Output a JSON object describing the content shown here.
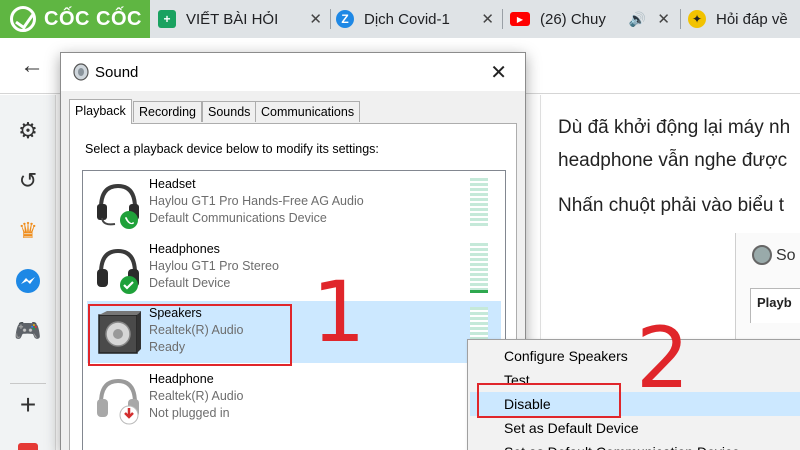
{
  "browser": {
    "logo_text": "CỐC CỐC",
    "tabs": [
      {
        "title": "VIẾT BÀI HỎI",
        "icon": "green-plus-icon",
        "color": "#1aa260"
      },
      {
        "title": "Dịch Covid-1",
        "icon": "zalo-z-icon",
        "color": "#1e88e5"
      },
      {
        "title": "(26) Chuy",
        "icon": "youtube-icon",
        "color": "#ff0000"
      },
      {
        "title": "Hỏi đáp về",
        "icon": "runner-icon",
        "color": "#f2c200"
      }
    ],
    "close_glyph": "✕",
    "back_glyph": "←"
  },
  "article": {
    "lines": [
      "Dù đã khởi động lại máy nh",
      "headphone vẫn nghe được",
      "Nhấn chuột phải vào biểu t"
    ],
    "inset_title": "So",
    "inset_tab": "Playb"
  },
  "dialog": {
    "title": "Sound",
    "close_glyph": "✕",
    "tabs": [
      "Playback",
      "Recording",
      "Sounds",
      "Communications"
    ],
    "instruction": "Select a playback device below to modify its settings:",
    "devices": [
      {
        "name": "Headset",
        "desc": "Haylou GT1 Pro Hands-Free AG Audio",
        "status": "Default Communications Device",
        "badge": "phone"
      },
      {
        "name": "Headphones",
        "desc": "Haylou GT1 Pro Stereo",
        "status": "Default Device",
        "badge": "check"
      },
      {
        "name": "Speakers",
        "desc": "Realtek(R) Audio",
        "status": "Ready",
        "badge": "none"
      },
      {
        "name": "Headphone",
        "desc": "Realtek(R) Audio",
        "status": "Not plugged in",
        "badge": "unplugged"
      }
    ]
  },
  "context_menu": {
    "items": [
      "Configure Speakers",
      "Test",
      "Disable",
      "Set as Default Device",
      "Set as Default Communication Device"
    ],
    "highlighted": "Disable"
  },
  "annotations": {
    "step1": "1",
    "step2": "2"
  },
  "colors": {
    "accent_red": "#e0262b",
    "selection_blue": "#cce8ff",
    "coccoc_green": "#5fb642"
  }
}
